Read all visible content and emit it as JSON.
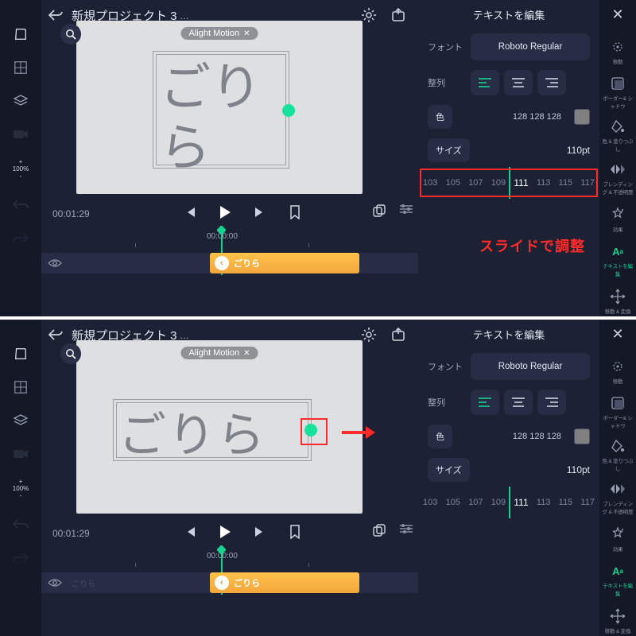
{
  "project_title": "新規プロジェクト 3",
  "ellipsis": "...",
  "watermark": "Alight Motion",
  "canvas_text_top": "ごり",
  "canvas_text_bottom": "ら",
  "canvas_text_single": "ごりら",
  "panel_title": "テキストを編集",
  "font_label": "フォント",
  "font_value": "Roboto Regular",
  "align_label": "整列",
  "color_label": "色",
  "color_value": "128 128 128",
  "size_label": "サイズ",
  "size_value": "110pt",
  "ruler_ticks": [
    "103",
    "105",
    "107",
    "109",
    "111",
    "113",
    "115",
    "117"
  ],
  "annotation_slide": "スライドで調整",
  "timecode": "00:01:29",
  "ruler_time": "00:00:00",
  "zoom_plus": "+",
  "zoom_val": "100%",
  "zoom_minus": "-",
  "clip_label": "ごりら",
  "track_label": "ごりら",
  "rtool": {
    "close": "✕",
    "items": [
      {
        "label": "移動"
      },
      {
        "label": "ボーダー& シャドウ"
      },
      {
        "label": "色 & 塗りつぶし"
      },
      {
        "label": "ブレンディング & 不透明度"
      },
      {
        "label": "効果"
      },
      {
        "label": "テキストを編集"
      },
      {
        "label": "移動 & 変換"
      }
    ]
  }
}
